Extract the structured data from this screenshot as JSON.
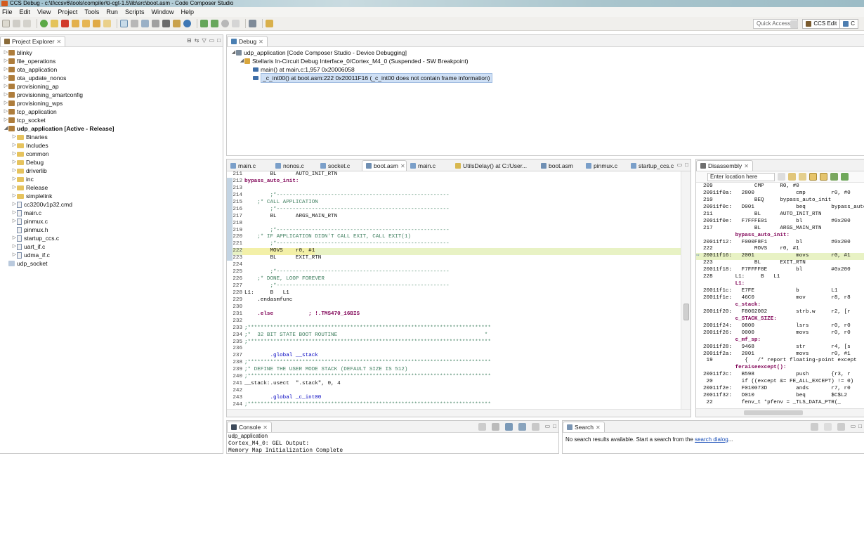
{
  "window": {
    "title": "CCS Debug - c:\\ti\\ccsv6\\tools\\compiler\\ti-cgt-1.5\\lib\\src\\boot.asm - Code Composer Studio"
  },
  "menu": [
    "File",
    "Edit",
    "View",
    "Project",
    "Tools",
    "Run",
    "Scripts",
    "Window",
    "Help"
  ],
  "toolbar": {
    "quick_access": "Quick Access",
    "perspective": "CCS Edit",
    "perspective_short": "C"
  },
  "project_explorer": {
    "title": "Project Explorer",
    "items": [
      {
        "label": "blinky",
        "level": 0,
        "kind": "project"
      },
      {
        "label": "file_operations",
        "level": 0,
        "kind": "project"
      },
      {
        "label": "ota_application",
        "level": 0,
        "kind": "project"
      },
      {
        "label": "ota_update_nonos",
        "level": 0,
        "kind": "project"
      },
      {
        "label": "provisioning_ap",
        "level": 0,
        "kind": "project"
      },
      {
        "label": "provisioning_smartconfig",
        "level": 0,
        "kind": "project"
      },
      {
        "label": "provisioning_wps",
        "level": 0,
        "kind": "project"
      },
      {
        "label": "tcp_application",
        "level": 0,
        "kind": "project"
      },
      {
        "label": "tcp_socket",
        "level": 0,
        "kind": "project"
      },
      {
        "label": "udp_application  [Active - Release]",
        "level": 0,
        "kind": "project",
        "expanded": true,
        "bold": true
      },
      {
        "label": "Binaries",
        "level": 1,
        "kind": "folder"
      },
      {
        "label": "Includes",
        "level": 1,
        "kind": "folder"
      },
      {
        "label": "common",
        "level": 1,
        "kind": "folder"
      },
      {
        "label": "Debug",
        "level": 1,
        "kind": "folder"
      },
      {
        "label": "driverlib",
        "level": 1,
        "kind": "folder"
      },
      {
        "label": "inc",
        "level": 1,
        "kind": "folder"
      },
      {
        "label": "Release",
        "level": 1,
        "kind": "folder"
      },
      {
        "label": "simplelink",
        "level": 1,
        "kind": "folder"
      },
      {
        "label": "cc3200v1p32.cmd",
        "level": 1,
        "kind": "file"
      },
      {
        "label": "main.c",
        "level": 1,
        "kind": "file"
      },
      {
        "label": "pinmux.c",
        "level": 1,
        "kind": "file"
      },
      {
        "label": "pinmux.h",
        "level": 1,
        "kind": "file"
      },
      {
        "label": "startup_ccs.c",
        "level": 1,
        "kind": "file"
      },
      {
        "label": "uart_if.c",
        "level": 1,
        "kind": "file"
      },
      {
        "label": "udma_if.c",
        "level": 1,
        "kind": "file"
      },
      {
        "label": "udp_socket",
        "level": 0,
        "kind": "project",
        "no_twisty": true
      }
    ]
  },
  "debug_view": {
    "title": "Debug",
    "rows": [
      {
        "label": "udp_application [Code Composer Studio - Device Debugging]",
        "level": 0
      },
      {
        "label": "Stellaris In-Circuit Debug Interface_0/Cortex_M4_0 (Suspended - SW Breakpoint)",
        "level": 1
      },
      {
        "label": "main() at main.c:1,957 0x20006058",
        "level": 2
      },
      {
        "label": "_c_int00() at boot.asm:222 0x20011F16  (_c_int00 does not contain frame information)",
        "level": 2,
        "selected": true
      }
    ]
  },
  "editor": {
    "tabs": [
      "main.c",
      "nonos.c",
      "socket.c",
      "boot.asm",
      "main.c",
      "UtilsDelay() at C:/User...",
      "boot.asm",
      "pinmux.c",
      "startup_ccs.c"
    ],
    "active_tab": 3,
    "lines": [
      {
        "n": "211",
        "t": "        BL      AUTO_INIT_RTN",
        "s": "n"
      },
      {
        "n": "212",
        "t": "bypass_auto_init:",
        "s": "k"
      },
      {
        "n": "213",
        "t": "",
        "s": "n"
      },
      {
        "n": "214",
        "t": "        ;*------------------------------------------------------",
        "s": "c"
      },
      {
        "n": "215",
        "t": "    ;* CALL APPLICATION",
        "s": "c"
      },
      {
        "n": "216",
        "t": "        ;*------------------------------------------------------",
        "s": "c"
      },
      {
        "n": "217",
        "t": "        BL      ARGS_MAIN_RTN",
        "s": "n"
      },
      {
        "n": "218",
        "t": "",
        "s": "n"
      },
      {
        "n": "219",
        "t": "        ;*------------------------------------------------------",
        "s": "c"
      },
      {
        "n": "220",
        "t": "    ;* IF APPLICATION DIDN'T CALL EXIT, CALL EXIT(1)",
        "s": "c"
      },
      {
        "n": "221",
        "t": "        ;*------------------------------------------------------",
        "s": "c"
      },
      {
        "n": "222",
        "t": "        MOVS    r0, #1",
        "s": "h"
      },
      {
        "n": "223",
        "t": "        BL      EXIT_RTN",
        "s": "n"
      },
      {
        "n": "224",
        "t": "",
        "s": "n"
      },
      {
        "n": "225",
        "t": "        ;*------------------------------------------------------",
        "s": "c"
      },
      {
        "n": "226",
        "t": "    ;* DONE, LOOP FOREVER",
        "s": "c"
      },
      {
        "n": "227",
        "t": "        ;*------------------------------------------------------",
        "s": "c"
      },
      {
        "n": "228",
        "t": "L1:     B   L1",
        "s": "n"
      },
      {
        "n": "229",
        "t": "    .endasmfunc",
        "s": "n"
      },
      {
        "n": "230",
        "t": "",
        "s": "n"
      },
      {
        "n": "231",
        "t": "    .else           ; !.TMS470_16BIS",
        "s": "e"
      },
      {
        "n": "232",
        "t": "",
        "s": "n"
      },
      {
        "n": "233",
        "t": ";****************************************************************************",
        "s": "c"
      },
      {
        "n": "234",
        "t": ";*  32 BIT STATE BOOT ROUTINE                                              *",
        "s": "c"
      },
      {
        "n": "235",
        "t": ";****************************************************************************",
        "s": "c"
      },
      {
        "n": "236",
        "t": "",
        "s": "n"
      },
      {
        "n": "237",
        "t": "        .global __stack",
        "s": "g"
      },
      {
        "n": "238",
        "t": ";****************************************************************************",
        "s": "c"
      },
      {
        "n": "239",
        "t": ";* DEFINE THE USER MODE STACK (DEFAULT SIZE IS 512)",
        "s": "c"
      },
      {
        "n": "240",
        "t": ";****************************************************************************",
        "s": "c"
      },
      {
        "n": "241",
        "t": "__stack:.usect  \".stack\", 0, 4",
        "s": "n"
      },
      {
        "n": "242",
        "t": "",
        "s": "n"
      },
      {
        "n": "243",
        "t": "        .global _c_int00",
        "s": "g"
      },
      {
        "n": "244",
        "t": ";****************************************************************************",
        "s": "c"
      }
    ]
  },
  "disassembly": {
    "title": "Disassembly",
    "location_placeholder": "Enter location here",
    "lines": [
      {
        "t": "209             CMP     R0, #0",
        "s": "n"
      },
      {
        "t": "20011f0a:   2800             cmp        r0, #0",
        "s": "n"
      },
      {
        "t": "210             BEQ     bypass_auto_init",
        "s": "n"
      },
      {
        "t": "20011f0c:   D001             beq        bypass_auto_init",
        "s": "n"
      },
      {
        "t": "211             BL      AUTO_INIT_RTN",
        "s": "n"
      },
      {
        "t": "20011f0e:   F7FFFE01         bl         #0x200",
        "s": "n"
      },
      {
        "t": "217             BL      ARGS_MAIN_RTN",
        "s": "n"
      },
      {
        "t": "          bypass_auto_init:",
        "s": "k"
      },
      {
        "t": "20011f12:   F000F8F1         bl         #0x200",
        "s": "n"
      },
      {
        "t": "222             MOVS    r0, #1",
        "s": "n"
      },
      {
        "t": "20011f16:   2001             movs       r0, #1",
        "s": "h"
      },
      {
        "t": "223             BL      EXIT_RTN",
        "s": "n"
      },
      {
        "t": "20011f18:   F7FFFF8E         bl         #0x200",
        "s": "n"
      },
      {
        "t": "228       L1:     B   L1",
        "s": "n"
      },
      {
        "t": "          L1:",
        "s": "k"
      },
      {
        "t": "20011f1c:   E7FE             b          L1",
        "s": "n"
      },
      {
        "t": "20011f1e:   46C0             mov        r8, r8",
        "s": "n"
      },
      {
        "t": "          c_stack:",
        "s": "k"
      },
      {
        "t": "20011f20:   F8002002         strb.w     r2, [r",
        "s": "n"
      },
      {
        "t": "          c_STACK_SIZE:",
        "s": "k"
      },
      {
        "t": "20011f24:   0800             lsrs       r0, r0",
        "s": "n"
      },
      {
        "t": "20011f26:   0000             movs       r0, r0",
        "s": "n"
      },
      {
        "t": "          c_mf_sp:",
        "s": "k"
      },
      {
        "t": "20011f28:   9468             str        r4, [s",
        "s": "n"
      },
      {
        "t": "20011f2a:   2001             movs       r0, #1",
        "s": "n"
      },
      {
        "t": " 19          {   /* report floating-point except",
        "s": "n"
      },
      {
        "t": "          feraiseexcept():",
        "s": "k"
      },
      {
        "t": "20011f2c:   B598             push       {r3, r",
        "s": "n"
      },
      {
        "t": " 20         if ((except &= FE_ALL_EXCEPT) != 0)",
        "s": "n"
      },
      {
        "t": "20011f2e:   F010073D         ands       r7, r0",
        "s": "n"
      },
      {
        "t": "20011f32:   D010             beq        $C$L2",
        "s": "n"
      },
      {
        "t": " 22         fenv_t *pfenv = _TLS_DATA_PTR(_",
        "s": "n"
      }
    ]
  },
  "console": {
    "title": "Console",
    "name": "udp_application",
    "lines": [
      "Cortex_M4_0: GEL Output:",
      "Memory Map Initialization Complete"
    ]
  },
  "search": {
    "title": "Search",
    "message": "No search results available. Start a search from the ",
    "link": "search dialog",
    "suffix": "..."
  }
}
